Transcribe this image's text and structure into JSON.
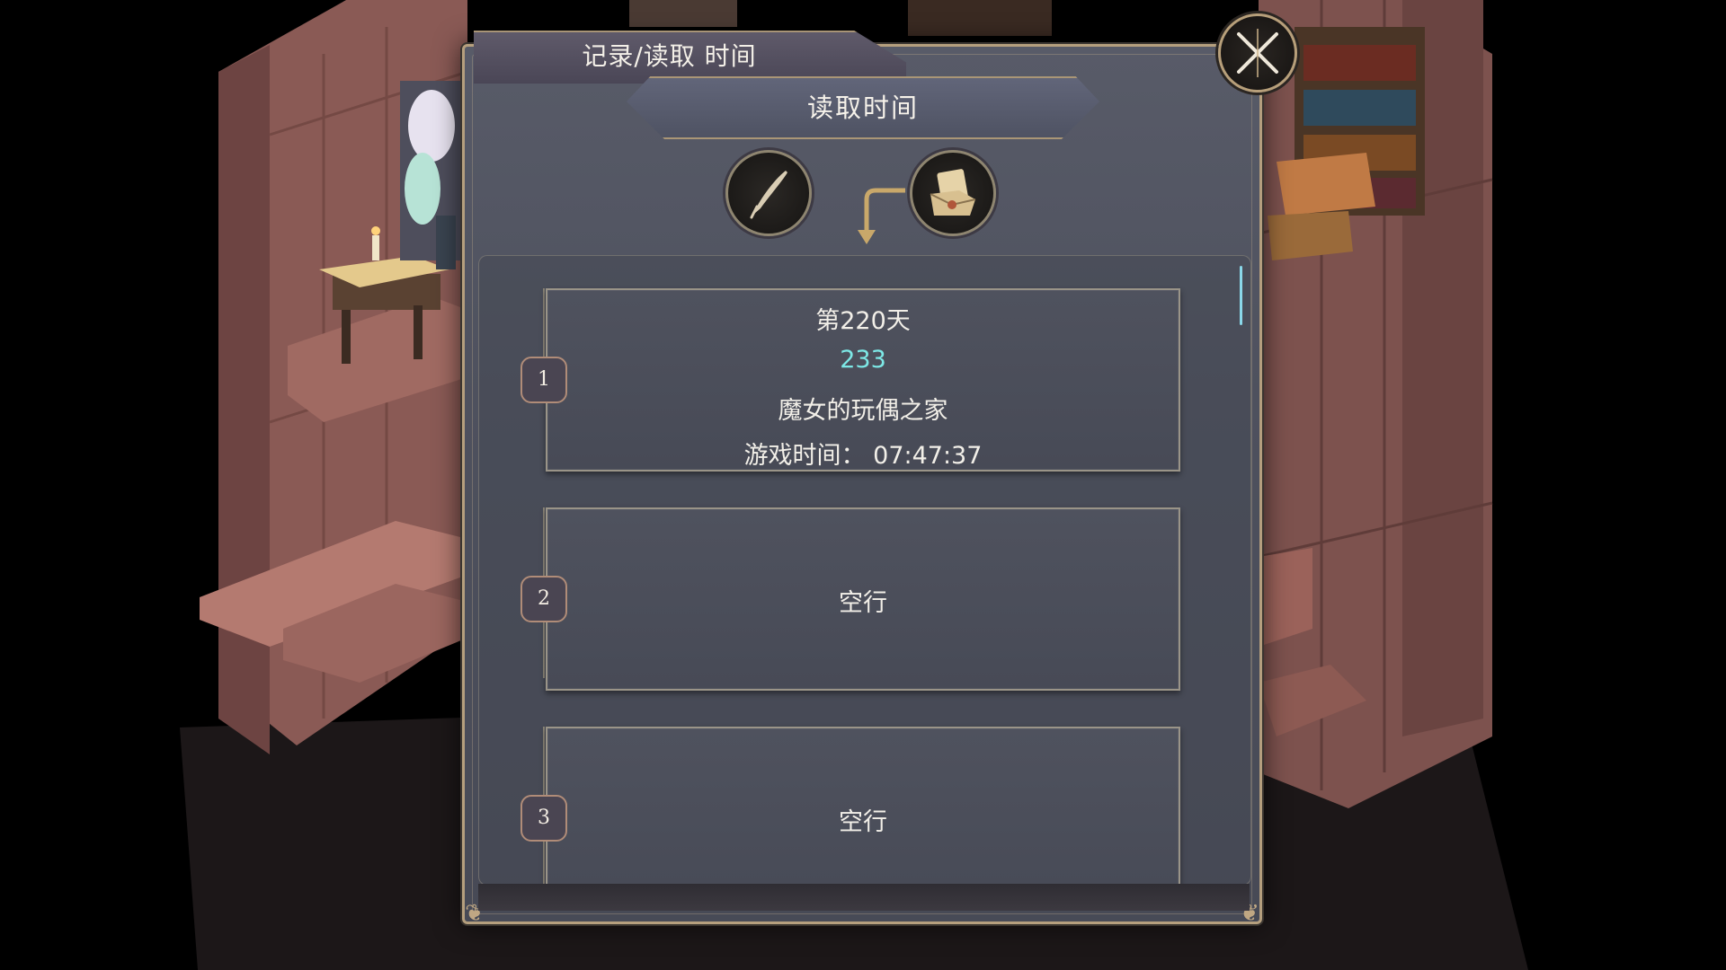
{
  "dialog": {
    "title": "记录/读取 时间",
    "subtitle": "读取时间"
  },
  "icons": {
    "close": "close-x-icon",
    "save_mode": "quill-pen-icon",
    "load_mode": "scroll-letter-icon",
    "direction": "curved-arrow-down-icon"
  },
  "slots": [
    {
      "number": "1",
      "day": "第220天",
      "name": "233",
      "location": "魔女的玩偶之家",
      "playtime": "游戏时间： 07:47:37"
    },
    {
      "number": "2",
      "empty_label": "空行"
    },
    {
      "number": "3",
      "empty_label": "空行"
    }
  ],
  "colors": {
    "frame_gold": "#b59f7e",
    "save_name_cyan": "#7de8e6",
    "panel_slate": "#4e515e"
  }
}
